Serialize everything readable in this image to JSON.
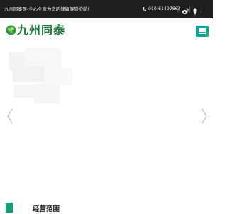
{
  "topbar": {
    "slogan": "九州同泰医-全心全意为您的健康保驾护航!",
    "phone": "010-61497863",
    "icons": [
      "weibo-icon",
      "qq-icon"
    ]
  },
  "header": {
    "brand": "九州同泰",
    "logo": "tree-logo-icon",
    "menu_icon": "hamburger-menu-icon"
  },
  "banner": {
    "prev_icon": "chevron-left-icon",
    "next_icon": "chevron-right-icon"
  },
  "section": {
    "title": "经营范围"
  },
  "colors": {
    "topbar_bg": "#1f1f1f",
    "brand_green": "#1e7a3a",
    "menu_teal": "#0ea49a",
    "accent_green": "#0fa26f"
  }
}
